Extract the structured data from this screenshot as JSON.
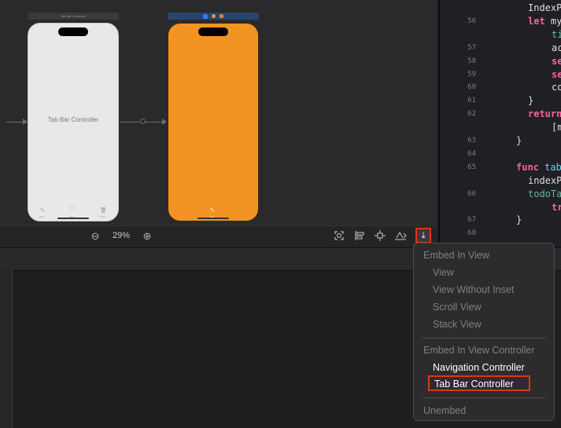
{
  "storyboard": {
    "scene_bar_left": "Tab Bar Controller",
    "tab_bar_controller_label": "Tab Bar Controller",
    "white_tabs": [
      {
        "glyph": "✎",
        "caption": "Edit"
      },
      {
        "glyph": "🗀",
        "caption": "Files"
      },
      {
        "glyph": "🗑",
        "caption": "Trash"
      }
    ],
    "orange_tab": {
      "glyph": "✎",
      "caption": "Item"
    }
  },
  "toolbar": {
    "zoom_out": "⊖",
    "zoom_level": "29%",
    "zoom_in": "⊕",
    "embed_glyph": "⤓"
  },
  "code": {
    "lines": [
      {
        "n": "",
        "segs": [
          {
            "c": "tx",
            "t": "IndexP"
          }
        ]
      },
      {
        "n": "56",
        "segs": [
          {
            "c": "kw",
            "t": "let "
          },
          {
            "c": "tx",
            "t": "my"
          }
        ]
      },
      {
        "n": "",
        "segs": [
          {
            "c": "cy",
            "t": "ti"
          }
        ]
      },
      {
        "n": "57",
        "segs": [
          {
            "c": "tx",
            "t": "ac"
          }
        ]
      },
      {
        "n": "58",
        "segs": [
          {
            "c": "kw",
            "t": "se"
          }
        ]
      },
      {
        "n": "59",
        "segs": [
          {
            "c": "kw",
            "t": "se"
          }
        ]
      },
      {
        "n": "60",
        "segs": [
          {
            "c": "tx",
            "t": "co"
          }
        ]
      },
      {
        "n": "61",
        "segs": [
          {
            "c": "tx",
            "t": "}"
          }
        ]
      },
      {
        "n": "62",
        "segs": [
          {
            "c": "kw",
            "t": "return"
          }
        ]
      },
      {
        "n": "",
        "segs": [
          {
            "c": "tx",
            "t": "[m"
          }
        ]
      },
      {
        "n": "63",
        "segs": [
          {
            "c": "tx",
            "t": "}"
          }
        ]
      },
      {
        "n": "64",
        "segs": []
      },
      {
        "n": "65",
        "segs": [
          {
            "c": "kw",
            "t": "func "
          },
          {
            "c": "ty",
            "t": "table"
          }
        ]
      },
      {
        "n": "",
        "segs": [
          {
            "c": "tx",
            "t": "indexP"
          }
        ]
      },
      {
        "n": "66",
        "segs": [
          {
            "c": "cy",
            "t": "todoTa"
          }
        ]
      },
      {
        "n": "",
        "segs": [
          {
            "c": "kw",
            "t": "tr"
          }
        ]
      },
      {
        "n": "67",
        "segs": [
          {
            "c": "tx",
            "t": "}"
          }
        ]
      },
      {
        "n": "68",
        "segs": []
      }
    ]
  },
  "menu": {
    "embed_in_view": "Embed In View",
    "view": "View",
    "view_without_inset": "View Without Inset",
    "scroll_view": "Scroll View",
    "stack_view": "Stack View",
    "embed_in_view_controller": "Embed In View Controller",
    "navigation_controller": "Navigation Controller",
    "tab_bar_controller": "Tab Bar Controller",
    "unembed": "Unembed"
  }
}
